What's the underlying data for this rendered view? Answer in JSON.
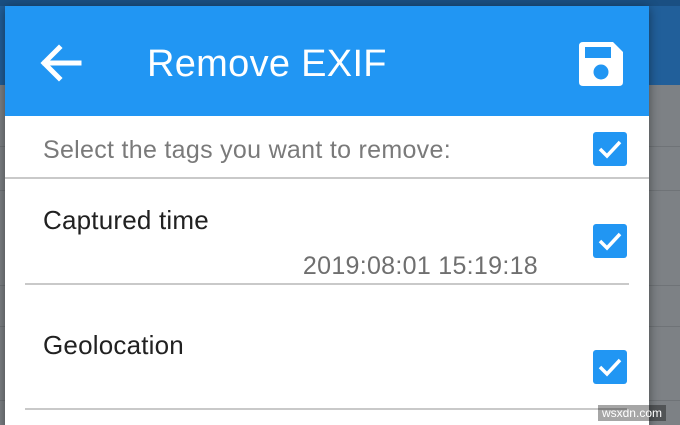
{
  "dialog": {
    "title": "Remove EXIF",
    "back_icon": "arrow-left-icon",
    "save_icon": "floppy-disk-icon",
    "instruction": "Select the tags you want to remove:",
    "select_all_checked": true,
    "tags": [
      {
        "label": "Captured time",
        "value": "2019:08:01 15:19:18",
        "checked": true
      },
      {
        "label": "Geolocation",
        "value": "",
        "checked": true
      }
    ]
  },
  "watermark": "wsxdn.com",
  "colors": {
    "header": "#2196f3",
    "checkbox": "#2196f3",
    "background_app_bar": "#215f9a",
    "dim_overlay": "#7d8185"
  }
}
